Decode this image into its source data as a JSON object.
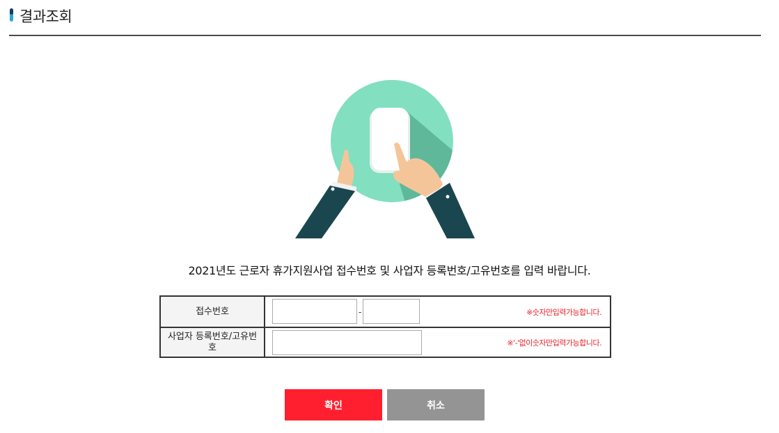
{
  "header": {
    "title": "결과조회"
  },
  "main": {
    "instruction": "2021년도 근로자 휴가지원사업 접수번호 및 사업자 등록번호/고유번호를 입력 바랍니다.",
    "form": {
      "receipt_number": {
        "label": "접수번호",
        "part1_value": "",
        "part2_value": "",
        "separator": "-",
        "hint": "※숫자만입력가능합니다."
      },
      "business_number": {
        "label": "사업자 등록번호/고유번호",
        "value": "",
        "hint": "※'-'없이숫자만입력가능합니다."
      }
    },
    "buttons": {
      "confirm": "확인",
      "cancel": "취소"
    }
  },
  "colors": {
    "accent_red": "#ff1f2e",
    "cancel_gray": "#949494",
    "illustration_mint": "#82dfc0",
    "sleeve_dark": "#1a4650"
  },
  "icons": {
    "illustration": "hands-tapping-phone-illustration"
  }
}
